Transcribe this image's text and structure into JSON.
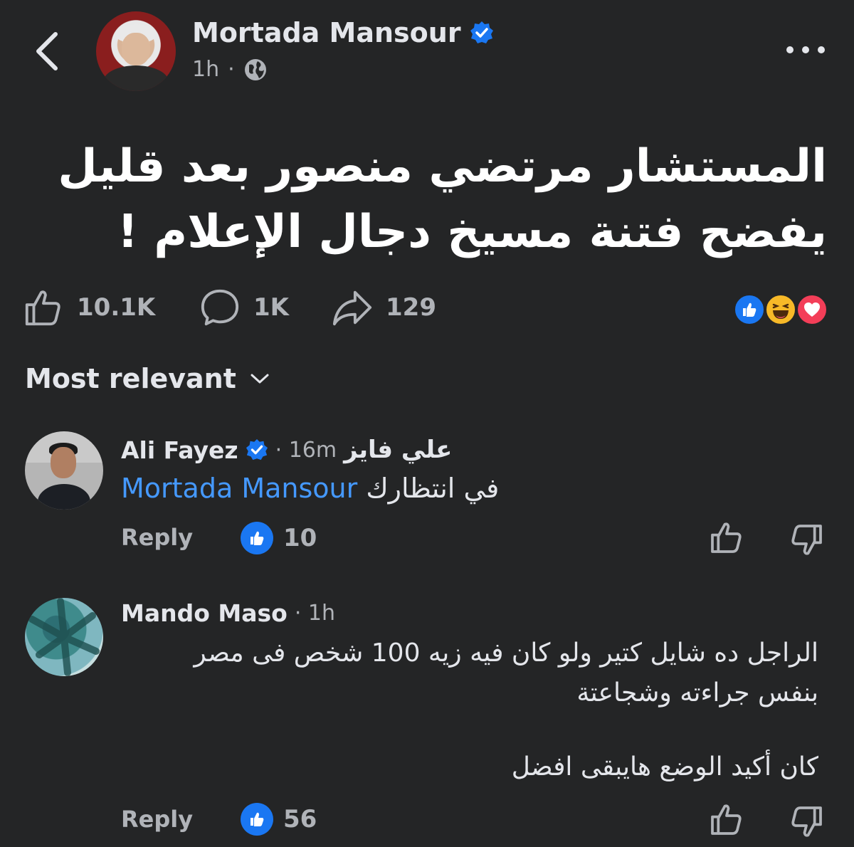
{
  "post": {
    "author": "Mortada Mansour",
    "time": "1h",
    "separator": "·",
    "text_line1": "المستشار مرتضي منصور بعد قليل",
    "text_line2": "يفضح فتنة مسيخ دجال الإعلام !",
    "likes": "10.1K",
    "comments": "1K",
    "shares": "129",
    "reactions": [
      "like-icon",
      "haha-icon",
      "love-icon"
    ]
  },
  "sort": {
    "label": "Most relevant"
  },
  "comments": [
    {
      "author": "Ali Fayez",
      "time": "· 16m",
      "original_name": "علي  فايز",
      "text_ar": "في انتظارك",
      "mention": "Mortada Mansour",
      "reply_label": "Reply",
      "likes": "10"
    },
    {
      "author": "Mando Maso",
      "time": "· 1h",
      "line1": "الراجل ده شايل كتير ولو كان فيه زيه 100 شخص فى مصر",
      "line2": "بنفس جراءته وشجاعتة",
      "line3": "كان أكيد الوضع هايبقى افضل",
      "reply_label": "Reply",
      "likes": "56"
    }
  ],
  "colors": {
    "background": "#242526",
    "text": "#e4e6eb",
    "secondary": "#b0b3b8",
    "accent": "#1a77f2",
    "mention": "#4599ff"
  }
}
